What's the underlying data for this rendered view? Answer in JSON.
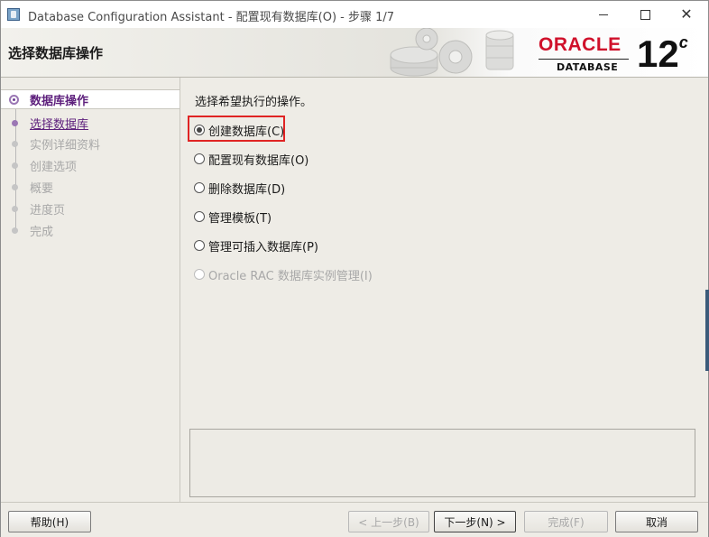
{
  "window": {
    "title": "Database Configuration Assistant - 配置现有数据库(O) - 步骤 1/7"
  },
  "banner": {
    "title": "选择数据库操作",
    "logo_brand": "ORACLE",
    "logo_product": "DATABASE",
    "logo_version": "12",
    "logo_version_suffix": "c"
  },
  "nav": {
    "items": [
      {
        "label": "数据库操作",
        "state": "current"
      },
      {
        "label": "选择数据库",
        "state": "link"
      },
      {
        "label": "实例详细资料",
        "state": "disabled"
      },
      {
        "label": "创建选项",
        "state": "disabled"
      },
      {
        "label": "概要",
        "state": "disabled"
      },
      {
        "label": "进度页",
        "state": "disabled"
      },
      {
        "label": "完成",
        "state": "disabled"
      }
    ]
  },
  "content": {
    "prompt": "选择希望执行的操作。",
    "options": [
      {
        "label": "创建数据库(C)",
        "checked": true,
        "enabled": true
      },
      {
        "label": "配置现有数据库(O)",
        "checked": false,
        "enabled": true
      },
      {
        "label": "删除数据库(D)",
        "checked": false,
        "enabled": true
      },
      {
        "label": "管理模板(T)",
        "checked": false,
        "enabled": true
      },
      {
        "label": "管理可插入数据库(P)",
        "checked": false,
        "enabled": true
      },
      {
        "label": "Oracle RAC 数据库实例管理(I)",
        "checked": false,
        "enabled": false
      }
    ]
  },
  "buttons": {
    "help": "帮助(H)",
    "back": "< 上一步(B)",
    "next": "下一步(N) >",
    "finish": "完成(F)",
    "cancel": "取消"
  },
  "colors": {
    "accent": "#5d1f7c",
    "oracle_red": "#d0112b",
    "highlight": "#e02424"
  }
}
